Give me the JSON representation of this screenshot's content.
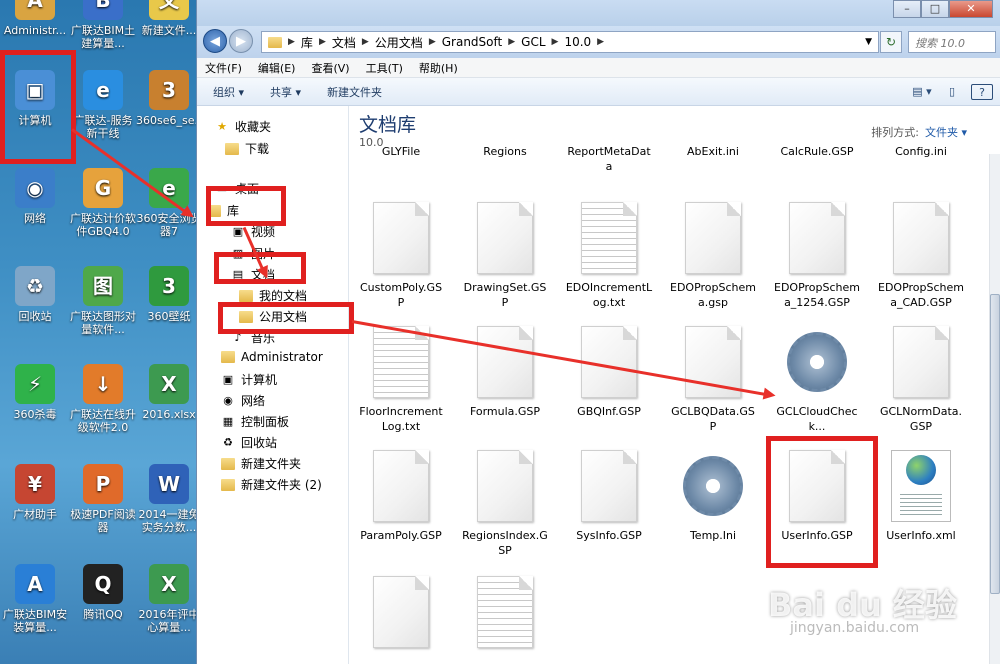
{
  "desktop": {
    "icons": [
      {
        "label": "Administr...",
        "color": "#d9a441",
        "glyph": "A"
      },
      {
        "label": "广联达BIM土建算量...",
        "color": "#3a6fc9",
        "glyph": "B"
      },
      {
        "label": "新建文件...",
        "color": "#e8c84a",
        "glyph": "文"
      },
      {
        "label": "计算机",
        "color": "#4a8fd6",
        "glyph": "▣"
      },
      {
        "label": "广联达-服务新干线",
        "color": "#2a8ee0",
        "glyph": "e"
      },
      {
        "label": "360se6_se...",
        "color": "#c8802f",
        "glyph": "3"
      },
      {
        "label": "网络",
        "color": "#3b7ec9",
        "glyph": "◉"
      },
      {
        "label": "广联达计价软件GBQ4.0",
        "color": "#e6a23c",
        "glyph": "G"
      },
      {
        "label": "360安全浏览器7",
        "color": "#3aa84a",
        "glyph": "e"
      },
      {
        "label": "回收站",
        "color": "#7fa6c8",
        "glyph": "♻"
      },
      {
        "label": "广联达图形对量软件...",
        "color": "#4fa84a",
        "glyph": "图"
      },
      {
        "label": "360壁纸",
        "color": "#2f9a3e",
        "glyph": "3"
      },
      {
        "label": "360杀毒",
        "color": "#2fb24a",
        "glyph": "⚡"
      },
      {
        "label": "广联达在线升级软件2.0",
        "color": "#e27b2a",
        "glyph": "↓"
      },
      {
        "label": "2016.xlsx",
        "color": "#3d9a50",
        "glyph": "X"
      },
      {
        "label": "广材助手",
        "color": "#c64632",
        "glyph": "¥"
      },
      {
        "label": "极速PDF阅读器",
        "color": "#e06a2a",
        "glyph": "P"
      },
      {
        "label": "2014一建免实务分数...",
        "color": "#2f62b8",
        "glyph": "W"
      },
      {
        "label": "广联达BIM安装算量...",
        "color": "#2a7fd6",
        "glyph": "A"
      },
      {
        "label": "腾讯QQ",
        "color": "#222222",
        "glyph": "Q"
      },
      {
        "label": "2016年评中心算量...",
        "color": "#3d9a50",
        "glyph": "X"
      }
    ]
  },
  "window": {
    "controls": {
      "minimize": "–",
      "maximize": "□",
      "close": "✕"
    },
    "address": {
      "crumbs": [
        "库",
        "文档",
        "公用文档",
        "GrandSoft",
        "GCL",
        "10.0"
      ],
      "search_placeholder": "搜索 10.0"
    },
    "menu": [
      "文件(F)",
      "编辑(E)",
      "查看(V)",
      "工具(T)",
      "帮助(H)"
    ],
    "toolbar": [
      "组织 ▾",
      "共享 ▾",
      "新建文件夹"
    ],
    "nav": [
      {
        "label": "收藏夹",
        "icon": "star-icon"
      },
      {
        "label": "下载",
        "icon": "folder-icon"
      },
      {
        "label": "桌面",
        "icon": "desktop-icon"
      },
      {
        "label": "库",
        "icon": "library-icon"
      },
      {
        "label": "视频",
        "icon": "video-icon"
      },
      {
        "label": "图片",
        "icon": "picture-icon"
      },
      {
        "label": "文档",
        "icon": "document-icon"
      },
      {
        "label": "我的文档",
        "icon": "folder-icon"
      },
      {
        "label": "公用文档",
        "icon": "folder-icon"
      },
      {
        "label": "音乐",
        "icon": "music-icon"
      },
      {
        "label": "Administrator",
        "icon": "folder-icon"
      },
      {
        "label": "计算机",
        "icon": "computer-icon"
      },
      {
        "label": "网络",
        "icon": "network-icon"
      },
      {
        "label": "控制面板",
        "icon": "control-panel-icon"
      },
      {
        "label": "回收站",
        "icon": "recycle-bin-icon"
      },
      {
        "label": "新建文件夹",
        "icon": "folder-icon"
      },
      {
        "label": "新建文件夹 (2)",
        "icon": "folder-icon"
      }
    ],
    "library": {
      "title": "文档库",
      "subtitle": "10.0",
      "arrange_label": "排列方式:",
      "arrange_value": "文件夹 ▾"
    },
    "files": [
      {
        "name": "GLYFile",
        "kind": "partial"
      },
      {
        "name": "Regions",
        "kind": "partial"
      },
      {
        "name": "ReportMetaData",
        "kind": "partial"
      },
      {
        "name": "AbExit.ini",
        "kind": "partial"
      },
      {
        "name": "CalcRule.GSP",
        "kind": "partial"
      },
      {
        "name": "Config.ini",
        "kind": "partial"
      },
      {
        "name": "CustomPoly.GSP",
        "kind": "doc"
      },
      {
        "name": "DrawingSet.GSP",
        "kind": "doc"
      },
      {
        "name": "EDOIncrementLog.txt",
        "kind": "txt"
      },
      {
        "name": "EDOPropSchema.gsp",
        "kind": "doc"
      },
      {
        "name": "EDOPropSchema_1254.GSP",
        "kind": "doc"
      },
      {
        "name": "EDOPropSchema_CAD.GSP",
        "kind": "doc"
      },
      {
        "name": "FloorIncrementLog.txt",
        "kind": "txt"
      },
      {
        "name": "Formula.GSP",
        "kind": "doc"
      },
      {
        "name": "GBQInf.GSP",
        "kind": "doc"
      },
      {
        "name": "GCLBQData.GSP",
        "kind": "doc"
      },
      {
        "name": "GCLCloudCheck...",
        "kind": "gear"
      },
      {
        "name": "GCLNormData.GSP",
        "kind": "doc"
      },
      {
        "name": "ParamPoly.GSP",
        "kind": "doc"
      },
      {
        "name": "RegionsIndex.GSP",
        "kind": "doc"
      },
      {
        "name": "SysInfo.GSP",
        "kind": "doc"
      },
      {
        "name": "Temp.Ini",
        "kind": "gear"
      },
      {
        "name": "UserInfo.GSP",
        "kind": "doc"
      },
      {
        "name": "UserInfo.xml",
        "kind": "xml"
      },
      {
        "name": "",
        "kind": "doc"
      },
      {
        "name": "",
        "kind": "txt"
      }
    ]
  },
  "watermark": {
    "logo": "Bai du 经验",
    "url": "jingyan.baidu.com"
  },
  "colors": {
    "highlight_red": "#e0201f",
    "library_title": "#1e3d70"
  }
}
